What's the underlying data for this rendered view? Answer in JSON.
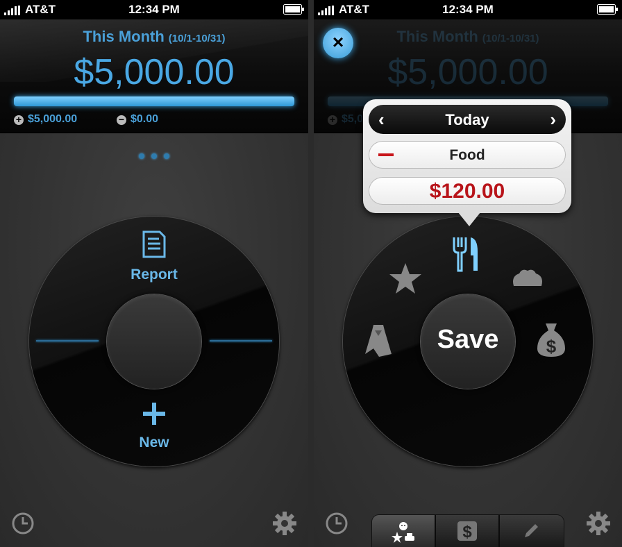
{
  "status": {
    "carrier": "AT&T",
    "time": "12:34 PM"
  },
  "summary": {
    "title": "This Month",
    "range": "(10/1-10/31)",
    "total": "$5,000.00",
    "income": "$5,000.00",
    "expense": "$0.00",
    "progress": 1.0
  },
  "wheel": {
    "report_label": "Report",
    "new_label": "New"
  },
  "entry": {
    "date_label": "Today",
    "category": "Food",
    "amount": "$120.00",
    "save_label": "Save"
  },
  "colors": {
    "accent": "#4aa8e4",
    "expense_red": "#b8141a"
  }
}
